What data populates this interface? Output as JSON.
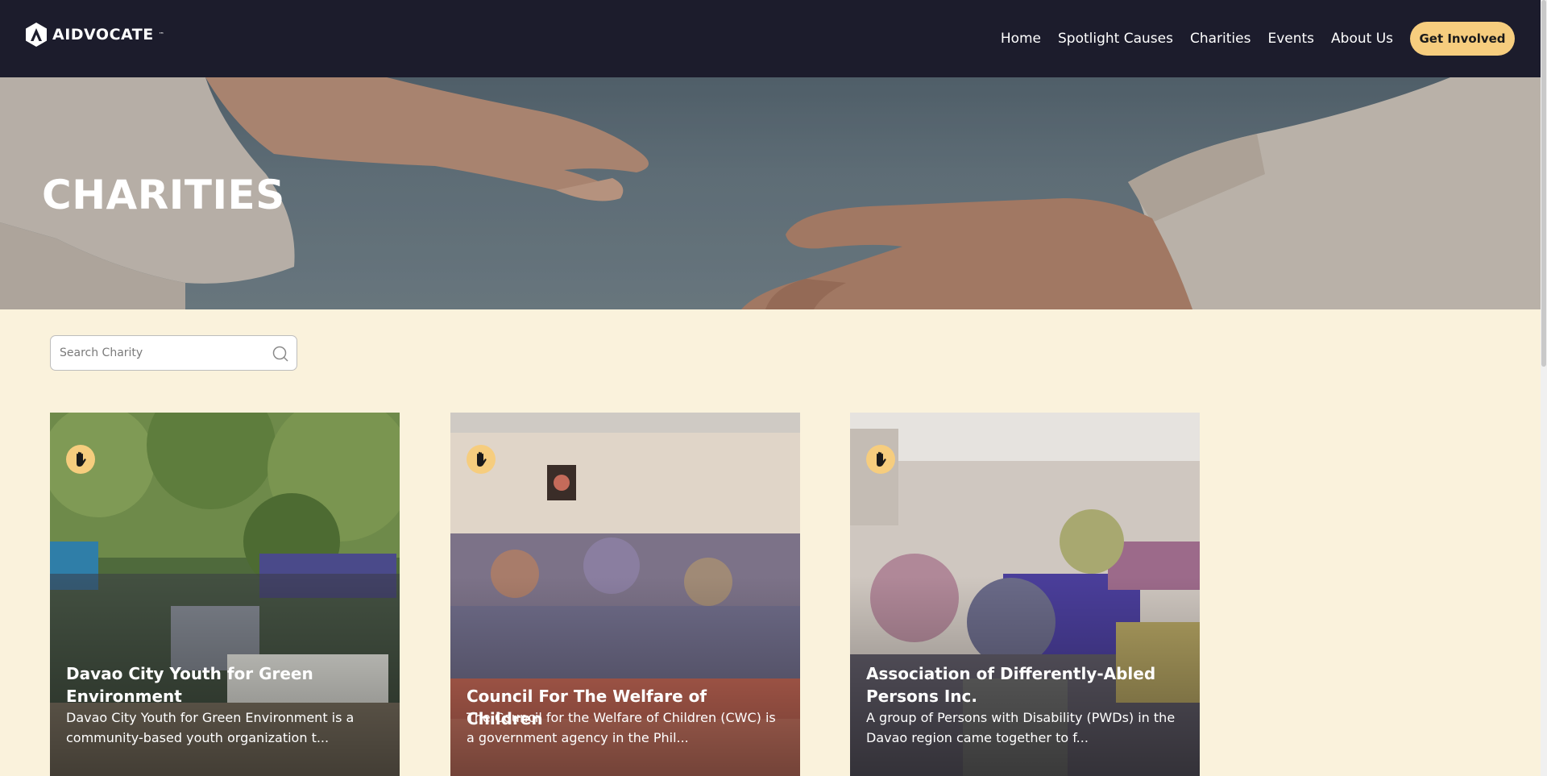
{
  "brand": {
    "name": "AIDVOCATE",
    "tm": "™",
    "icon": "aidvocate-logo-icon"
  },
  "nav": {
    "links": [
      "Home",
      "Spotlight Causes",
      "Charities",
      "Events",
      "About Us"
    ],
    "cta": "Get Involved"
  },
  "hero": {
    "title": "CHARITIES"
  },
  "search": {
    "placeholder": "Search Charity",
    "value": "",
    "icon": "search-icon"
  },
  "cards": [
    {
      "title": "Davao City Youth for Green Environment",
      "description": "Davao City Youth for Green Environment is a community-based youth organization t...",
      "badge_icon": "hand-icon"
    },
    {
      "title": "Council For The Welfare of Children",
      "description": "The Council for the Welfare of Children (CWC) is a government agency in the Phil...",
      "badge_icon": "hand-icon"
    },
    {
      "title": "Association of Differently-Abled Persons Inc.",
      "description": "A group of Persons with Disability (PWDs) in the Davao region came together to f...",
      "badge_icon": "hand-icon"
    }
  ],
  "colors": {
    "navbar": "#1c1c2c",
    "accent": "#f6cd7e",
    "page_bg": "#faf2dc"
  }
}
